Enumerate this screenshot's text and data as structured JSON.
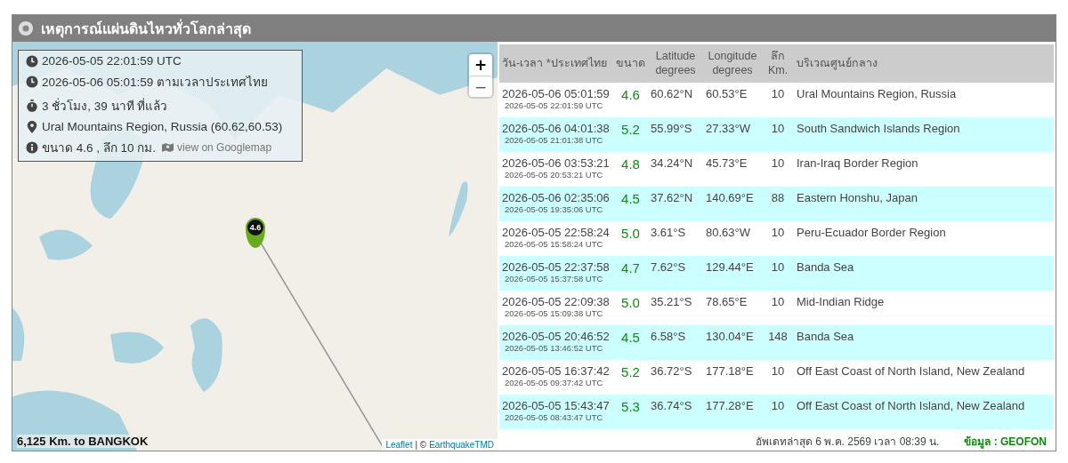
{
  "header": {
    "title": "เหตุการณ์แผ่นดินไหวทั่วโลกล่าสุด"
  },
  "map": {
    "info": {
      "utc": "2026-05-05 22:01:59 UTC",
      "local": "2026-05-06 05:01:59 ตามเวลาประเทศไทย",
      "elapsed": "3 ชั่วโมง, 39 นาที ที่แล้ว",
      "location": "Ural Mountains Region, Russia (60.62,60.53)",
      "magnitude_depth": "ขนาด 4.6 , ลึก 10 กม.",
      "map_link": "view on Googlemap"
    },
    "zoom_in": "+",
    "zoom_out": "−",
    "marker_label": "4.6",
    "distance": "6,125 Km. to BANGKOK",
    "attribution": {
      "library": "Leaflet",
      "separator": "| ©",
      "owner": "EarthquakeTMD"
    }
  },
  "table": {
    "columns": [
      {
        "lines": [
          "วัน-เวลา *ประเทศไทย"
        ]
      },
      {
        "lines": [
          "ขนาด"
        ]
      },
      {
        "lines": [
          "Latitude",
          "degrees"
        ]
      },
      {
        "lines": [
          "Longitude",
          "degrees"
        ]
      },
      {
        "lines": [
          "ลึก",
          "Km."
        ]
      },
      {
        "lines": [
          "บริเวณศูนย์กลาง"
        ]
      }
    ],
    "rows": [
      {
        "local": "2026-05-06 05:01:59",
        "utc": "2026-05-05 22:01:59 UTC",
        "magnitude": "4.6",
        "latitude": "60.62°N",
        "longitude": "60.53°E",
        "depth": "10",
        "region": "Ural Mountains Region, Russia"
      },
      {
        "local": "2026-05-06 04:01:38",
        "utc": "2026-05-05 21:01:38 UTC",
        "magnitude": "5.2",
        "latitude": "55.99°S",
        "longitude": "27.33°W",
        "depth": "10",
        "region": "South Sandwich Islands Region"
      },
      {
        "local": "2026-05-06 03:53:21",
        "utc": "2026-05-05 20:53:21 UTC",
        "magnitude": "4.8",
        "latitude": "34.24°N",
        "longitude": "45.73°E",
        "depth": "10",
        "region": "Iran-Iraq Border Region"
      },
      {
        "local": "2026-05-06 02:35:06",
        "utc": "2026-05-05 19:35:06 UTC",
        "magnitude": "4.5",
        "latitude": "37.62°N",
        "longitude": "140.69°E",
        "depth": "88",
        "region": "Eastern Honshu, Japan"
      },
      {
        "local": "2026-05-05 22:58:24",
        "utc": "2026-05-05 15:58:24 UTC",
        "magnitude": "5.0",
        "latitude": "3.61°S",
        "longitude": "80.63°W",
        "depth": "10",
        "region": "Peru-Ecuador Border Region"
      },
      {
        "local": "2026-05-05 22:37:58",
        "utc": "2026-05-05 15:37:58 UTC",
        "magnitude": "4.7",
        "latitude": "7.62°S",
        "longitude": "129.44°E",
        "depth": "10",
        "region": "Banda Sea"
      },
      {
        "local": "2026-05-05 22:09:38",
        "utc": "2026-05-05 15:09:38 UTC",
        "magnitude": "5.0",
        "latitude": "35.21°S",
        "longitude": "78.65°E",
        "depth": "10",
        "region": "Mid-Indian Ridge"
      },
      {
        "local": "2026-05-05 20:46:52",
        "utc": "2026-05-05 13:46:52 UTC",
        "magnitude": "4.5",
        "latitude": "6.58°S",
        "longitude": "130.04°E",
        "depth": "148",
        "region": "Banda Sea"
      },
      {
        "local": "2026-05-05 16:37:42",
        "utc": "2026-05-05 09:37:42 UTC",
        "magnitude": "5.2",
        "latitude": "36.72°S",
        "longitude": "177.18°E",
        "depth": "10",
        "region": "Off East Coast of North Island, New Zealand"
      },
      {
        "local": "2026-05-05 15:43:47",
        "utc": "2026-05-05 08:43:47 UTC",
        "magnitude": "5.3",
        "latitude": "36.74°S",
        "longitude": "177.28°E",
        "depth": "10",
        "region": "Off East Coast of North Island, New Zealand"
      }
    ]
  },
  "footer": {
    "updated": "อัพเดทล่าสุด 6 พ.ค. 2569 เวลา 08:39 น.",
    "source": "ข้อมูล : GEOFON"
  }
}
